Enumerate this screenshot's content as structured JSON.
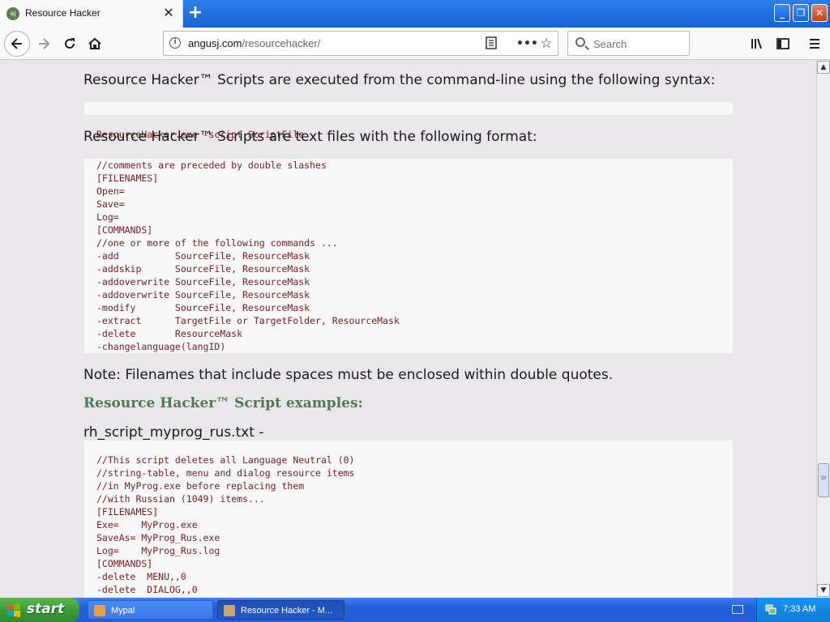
{
  "browser": {
    "tab_title": "Resource Hacker",
    "tab_icon": "aj",
    "url_host": "angusj.com",
    "url_path": "/resourcehacker/",
    "search_placeholder": "Search"
  },
  "content": {
    "para_syntax": "Resource Hacker™ Scripts are executed from the command-line using the following syntax:",
    "code_syntax": [
      "ResourceHacker.exe -script ScriptFile"
    ],
    "para_format": "Resource Hacker™ Scripts are text files with the following format:",
    "code_format": [
      "//comments are preceded by double slashes",
      "[FILENAMES]",
      "Open=",
      "Save=",
      "Log=",
      "[COMMANDS]",
      "//one or more of the following commands ...",
      "-add          SourceFile, ResourceMask",
      "-addskip      SourceFile, ResourceMask",
      "-addoverwrite SourceFile, ResourceMask",
      "-addoverwrite SourceFile, ResourceMask",
      "-modify       SourceFile, ResourceMask",
      "-extract      TargetFile or TargetFolder, ResourceMask",
      "-delete       ResourceMask",
      "-changelanguage(langID)"
    ],
    "para_note": "Note: Filenames that include spaces must be enclosed within double quotes.",
    "examples_heading": "Resource Hacker™ Script examples:",
    "example_filename": "rh_script_myprog_rus.txt -",
    "code_example": [
      "//This script deletes all Language Neutral (0)",
      "//string-table, menu and dialog resource items",
      "//in MyProg.exe before replacing them",
      "//with Russian (1049) items...",
      "[FILENAMES]",
      "Exe=    MyProg.exe",
      "SaveAs= MyProg_Rus.exe",
      "Log=    MyProg_Rus.log",
      "[COMMANDS]",
      "-delete  MENU,,0",
      "-delete  DIALOG,,0"
    ]
  },
  "taskbar": {
    "start_label": "start",
    "tasks": [
      {
        "label": "Mypal"
      },
      {
        "label": "Resource Hacker - M..."
      }
    ],
    "clock": "7:33 AM"
  },
  "colors": {
    "heading_green": "#4f7a53",
    "code_red": "#7a1c1c",
    "page_bg": "#e9e7ea"
  }
}
